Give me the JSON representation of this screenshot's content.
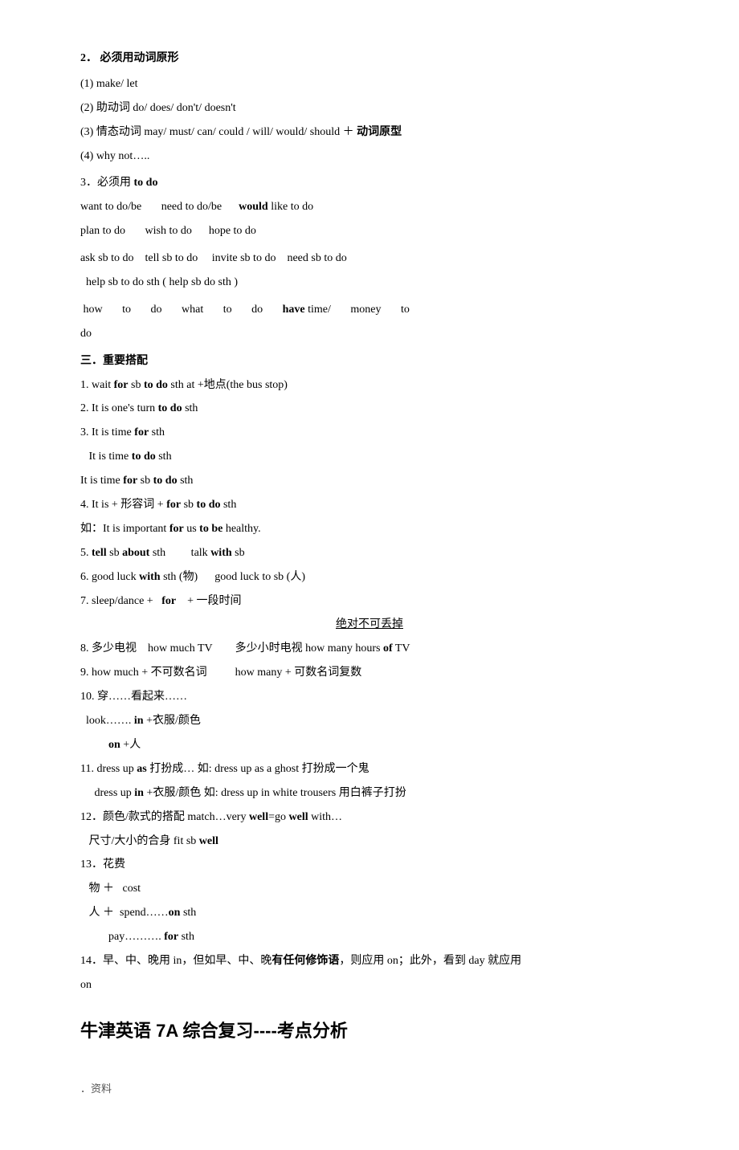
{
  "page": {
    "section2_title": "2．   必须用动词原形",
    "item1": "(1) make/ let",
    "item2": "(2)  助动词 do/ does/ don't/ doesn't",
    "item3": "(3)  情态动词 may/ must/ can/ could / will/ would/ should  ＋ 动词原型",
    "item4": "(4) why not…..",
    "section3_title": "3．必须用 to do",
    "row1_left": "want to do/be",
    "row1_mid": "need to do/be",
    "row1_right_bold": "would",
    "row1_right": " like to do",
    "row2_left": "plan to do",
    "row2_mid": "wish to do",
    "row2_right": "hope to do",
    "row3": "ask sb to do    tell sb to do     invite sb to do    need sb to do",
    "row4": "help sb to do sth ( help sb do sth )",
    "how_row_1": "how        to        do        what        to        do",
    "how_row_bold": "have",
    "how_row_2": " time/        money        to",
    "how_row_do": "do",
    "san_title": "三．重要搭配",
    "num1": "1. wait ",
    "num1_for": "for",
    "num1_rest": " sb ",
    "num1_todo": "to do",
    "num1_end": " sth  at +地点(the bus stop)",
    "num2": "2. It is one's turn ",
    "num2_todo": "to do",
    "num2_end": " sth",
    "num3": "3. It is time ",
    "num3_for": "for",
    "num3_end": " sth",
    "num3b": "   It is time ",
    "num3b_todo": "to do",
    "num3b_end": " sth",
    "num3c": "It is time ",
    "num3c_for": "for",
    "num3c_end": " sb ",
    "num3c_todo": "to do",
    "num3c_end2": " sth",
    "num4": "4. It is +  形容词 + ",
    "num4_for": "for",
    "num4_rest": " sb ",
    "num4_todo": "to do",
    "num4_end": " sth",
    "num4ex": "如：It is important ",
    "num4ex_for": "for",
    "num4ex_rest": " us ",
    "num4ex_tobe": "to be",
    "num4ex_end": " healthy.",
    "num5": "5. ",
    "num5_tell": "tell",
    "num5_rest": " sb ",
    "num5_about": "about",
    "num5_sth": " sth           talk ",
    "num5_with": "with",
    "num5_sb": " sb",
    "num6": "6. good luck ",
    "num6_with": "with",
    "num6_rest": " sth (物)        good luck to sb (人)",
    "num7": "7. sleep/dance +   ",
    "num7_for": "for",
    "num7_rest": "   +  一段时间",
    "num7_underline": "绝对不可丢掉",
    "num8": "8.  多少电视    how much TV        多少小时电视 how many hours ",
    "num8_of": "of",
    "num8_tv": " TV",
    "num9": "9. how much + 不可数名词         how many +  可数名词复数",
    "num10": "10.  穿……看起来……",
    "num10b": "  look……. ",
    "num10b_in": "in",
    "num10b_rest": " +衣服/颜色",
    "num10c": "         ",
    "num10c_on": "on",
    "num10c_rest": " +人",
    "num11": "11.  dress up ",
    "num11_as": "as",
    "num11_rest": " 打扮成…  如: dress up as a ghost  打扮成一个鬼",
    "num11b": "     dress up ",
    "num11b_in": "in",
    "num11b_rest": " +衣服/颜色  如: dress up in white trousers  用白裤子打扮",
    "num12": "12．颜色/款式的搭配  match…very ",
    "num12_well": "well",
    "num12_rest": "=go ",
    "num12_well2": "well",
    "num12_end": " with…",
    "num12b": "   尺寸/大小的合身  fit sb ",
    "num12b_well": "well",
    "num13": "13．花费",
    "num13a": "   物 ＋   cost",
    "num13b": "   人 ＋  spend……",
    "num13b_on": "on",
    "num13b_rest": " sth",
    "num13c": "          pay………. ",
    "num13c_for": "for",
    "num13c_rest": " sth",
    "num14": "14．早、中、晚用 in，但如早、中、晚",
    "num14_bold": "有任何修饰语",
    "num14_rest": "，则应用 on；此外，看到 day 就应用",
    "num14b": "on",
    "big_title": "牛津英语 7A 综合复习----考点分析",
    "footer": "．资料"
  }
}
